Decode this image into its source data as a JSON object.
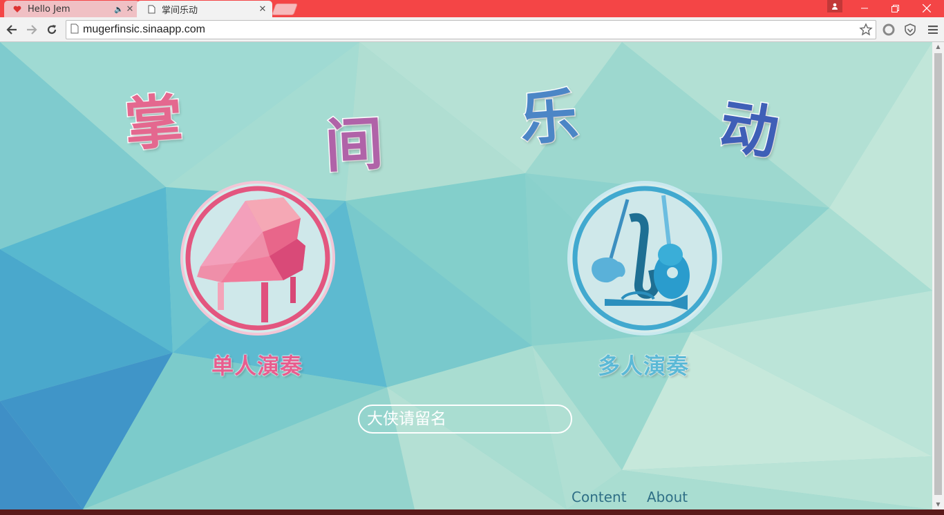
{
  "browser": {
    "tabs": [
      {
        "title": "Hello Jem",
        "active": false,
        "icon": "heart-icon",
        "audio": true
      },
      {
        "title": "掌间乐动",
        "active": true,
        "icon": "page-icon",
        "audio": false
      }
    ],
    "url": "mugerfinsic.sinaapp.com",
    "colors": {
      "tabbar": "#f44546",
      "toolbar": "#f2f2f2"
    }
  },
  "page": {
    "title_chars": [
      "掌",
      "间",
      "乐",
      "动"
    ],
    "modes": [
      {
        "label": "单人演奏",
        "icon": "piano-icon",
        "color": "#e85d8e"
      },
      {
        "label": "多人演奏",
        "icon": "instruments-icon",
        "color": "#5bb9d6"
      }
    ],
    "name_input": {
      "placeholder": "大侠请留名",
      "value": ""
    },
    "footer_links": [
      "Content",
      "About"
    ],
    "colors": {
      "bg_main": "#8fd3cf",
      "bg_dark": "#3f9ec6",
      "link": "#2f6f86"
    }
  }
}
